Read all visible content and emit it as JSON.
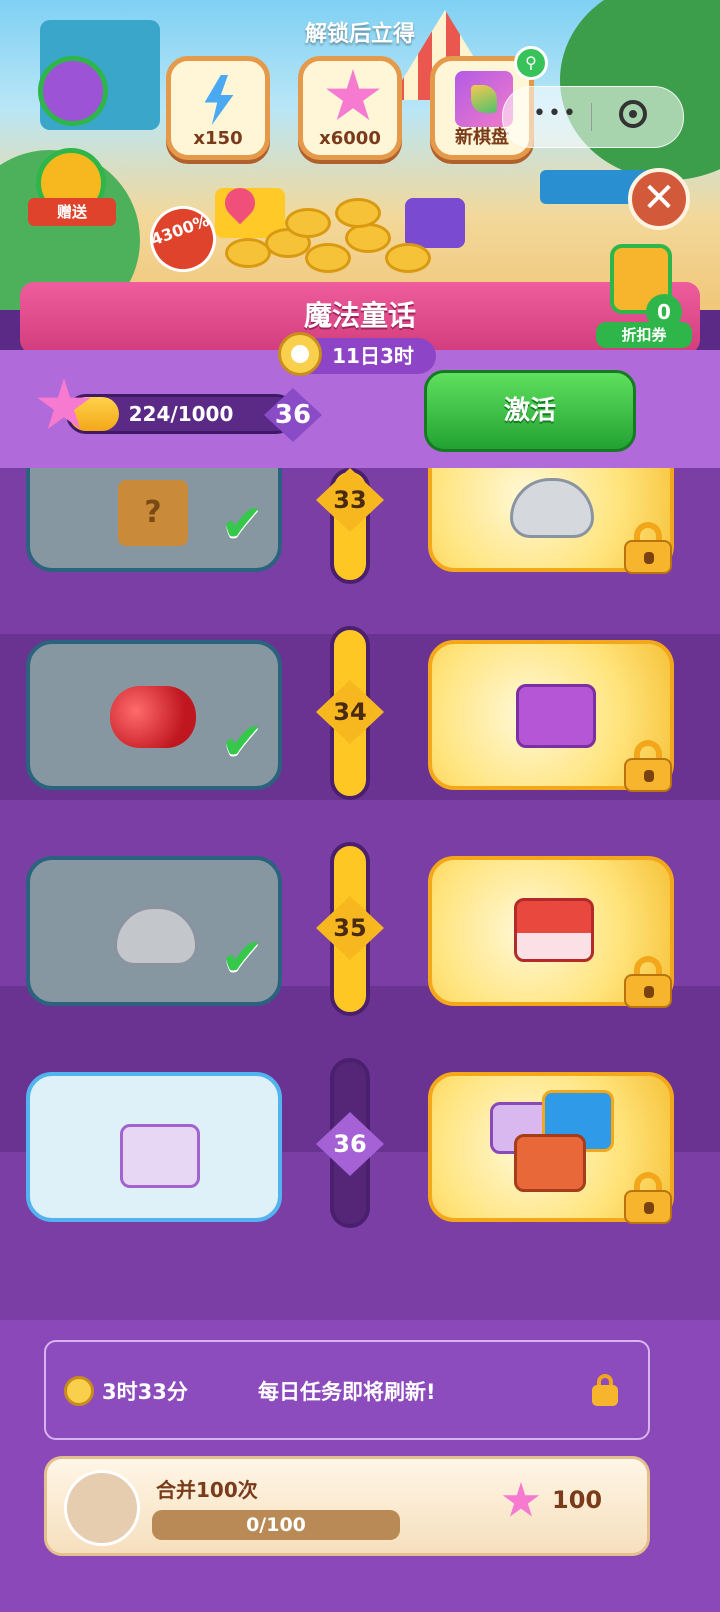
{
  "top": {
    "unlock_title": "解锁后立得",
    "rewards": [
      {
        "label": "x150",
        "icon": "energy-bolt-icon"
      },
      {
        "label": "x6000",
        "icon": "star-points-icon"
      },
      {
        "label": "新棋盘",
        "icon": "new-board-icon"
      }
    ],
    "gift_label": "赠送",
    "bonus_badge": "4300%",
    "close_icon": "close-icon",
    "capsule_dots": "•••"
  },
  "banner": {
    "title": "魔法童话",
    "timer": "11日3时",
    "voucher_count": "0",
    "voucher_label": "折扣券"
  },
  "progress": {
    "text": "224/1000",
    "fraction": 0.224,
    "level": "36",
    "activate_label": "激活"
  },
  "track": {
    "rows": [
      {
        "level": "33",
        "free_item": "mystery-cube-icon",
        "free_claimed": true,
        "paid_item": "shell-bowl-icon",
        "paid_locked": true
      },
      {
        "level": "34",
        "free_item": "rubies-icon",
        "free_claimed": true,
        "paid_item": "purple-chest-icon",
        "paid_locked": true
      },
      {
        "level": "35",
        "free_item": "silver-shell-icon",
        "free_claimed": true,
        "paid_item": "red-chest-icon",
        "paid_locked": true
      },
      {
        "level": "36",
        "free_item": "star-chest-icon",
        "free_claimed": false,
        "paid_item": "chest-bundle-icon",
        "paid_locked": true
      }
    ]
  },
  "daily": {
    "time": "3时33分",
    "message": "每日任务即将刷新!"
  },
  "task": {
    "title": "合并100次",
    "progress_text": "0/100",
    "reward": "100"
  },
  "colors": {
    "accent_green": "#2fb64a",
    "banner_pink": "#d13c7c",
    "purple": "#6b3391",
    "gold": "#f6b81e"
  }
}
